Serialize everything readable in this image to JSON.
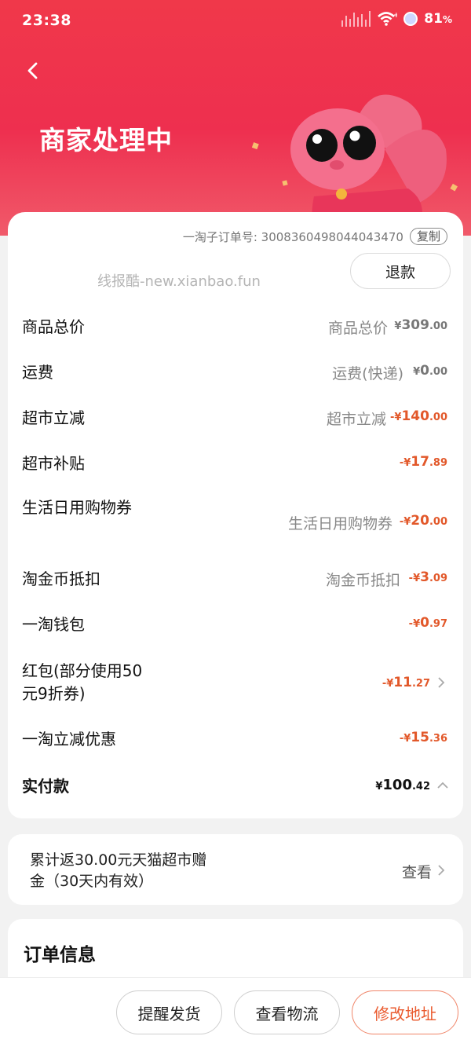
{
  "status": {
    "time": "23:38",
    "battery": "81"
  },
  "header": {
    "title": "商家处理中"
  },
  "order": {
    "number": "一淘子订单号: 3008360498044043470",
    "copy_label": "复制",
    "watermark": "线报酷-new.xianbao.fun",
    "refund_label": "退款"
  },
  "price_rows": [
    {
      "label": "商品总价",
      "sub": "商品总价",
      "cur": "¥",
      "int": "309",
      "dec": ".00",
      "color": "#777777"
    },
    {
      "label": "运费",
      "sub": "运费(快递)",
      "cur": "¥",
      "int": "0",
      "dec": ".00",
      "color": "#777777"
    },
    {
      "label": "超市立减",
      "sub": "超市立减",
      "cur": "-¥",
      "int": "140",
      "dec": ".00",
      "color": "#e2582a"
    },
    {
      "label": "超市补贴",
      "sub": "",
      "cur": "-¥",
      "int": "17",
      "dec": ".89",
      "color": "#e2582a"
    },
    {
      "label": "生活日用购物券",
      "sub": "生活日用购物券",
      "cur": "-¥",
      "int": "20",
      "dec": ".00",
      "color": "#e2582a"
    },
    {
      "label": "淘金币抵扣",
      "sub": "淘金币抵扣",
      "cur": "-¥",
      "int": "3",
      "dec": ".09",
      "color": "#e2582a"
    },
    {
      "label": "一淘钱包",
      "sub": "",
      "cur": "-¥",
      "int": "0",
      "dec": ".97",
      "color": "#e2582a"
    },
    {
      "label": "红包(部分使用50元9折券)",
      "sub": "",
      "cur": "-¥",
      "int": "11",
      "dec": ".27",
      "color": "#e2582a"
    },
    {
      "label": "一淘立减优惠",
      "sub": "",
      "cur": "-¥",
      "int": "15",
      "dec": ".36",
      "color": "#e2582a"
    },
    {
      "label": "实付款",
      "sub": "",
      "cur": "¥",
      "int": "100",
      "dec": ".42",
      "color": "#111111"
    }
  ],
  "rebate": {
    "text": "累计返30.00元天猫超市赠金（30天内有效）",
    "link": "查看"
  },
  "info": {
    "title": "订单信息"
  },
  "actions": {
    "remind": "提醒发货",
    "logistics": "查看物流",
    "address": "修改地址"
  }
}
